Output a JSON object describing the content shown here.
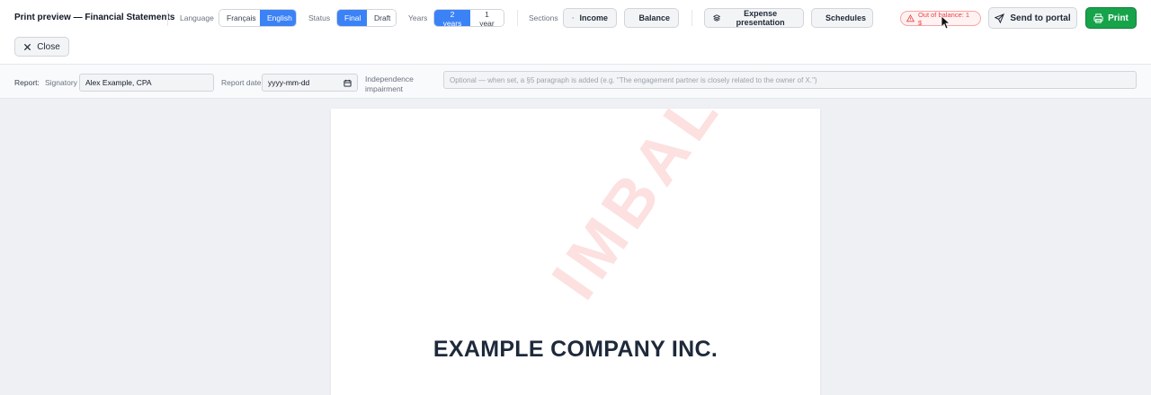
{
  "header": {
    "title": "Print preview — Financial Statements",
    "close_label": "Close"
  },
  "language": {
    "label": "Language",
    "options": [
      "Français",
      "English"
    ],
    "selected": "English"
  },
  "status": {
    "label": "Status",
    "options": [
      "Final",
      "Draft"
    ],
    "selected": "Final"
  },
  "years": {
    "label": "Years",
    "options": [
      "2 years",
      "1 year"
    ],
    "selected": "2 years"
  },
  "sections": {
    "label": "Sections",
    "income_label": "Income",
    "balance_label": "Balance"
  },
  "actions": {
    "expense_label": "Expense presentation",
    "schedules_label": "Schedules",
    "balance_badge": "Out of balance: 1 $",
    "send_label": "Send to portal",
    "print_label": "Print"
  },
  "report": {
    "label": "Report:",
    "signatory_label": "Signatory",
    "signatory_value": "Alex Example, CPA",
    "date_label": "Report date",
    "date_placeholder": "yyyy-mm-dd",
    "independence_label_1": "Independence",
    "independence_label_2": "impairment",
    "independence_placeholder": "Optional — when set, a §5 paragraph is added (e.g. \"The engagement partner is closely related to the owner of X.\")"
  },
  "document": {
    "company": "EXAMPLE COMPANY INC.",
    "watermark": "IMBALANCE"
  },
  "colors": {
    "accent": "#3b82f6",
    "print": "#16a34a",
    "warning": "#ef4444"
  }
}
